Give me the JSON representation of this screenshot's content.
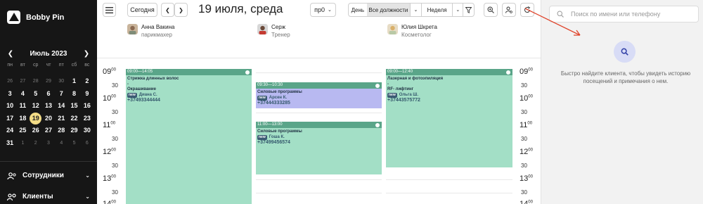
{
  "brand": {
    "name": "Bobby Pin"
  },
  "mini_calendar": {
    "month_label": "Июль 2023",
    "weekdays": [
      "пн",
      "вт",
      "ср",
      "чт",
      "пт",
      "сб",
      "вс"
    ],
    "days": [
      {
        "d": "26",
        "muted": true
      },
      {
        "d": "27",
        "muted": true
      },
      {
        "d": "28",
        "muted": true
      },
      {
        "d": "29",
        "muted": true
      },
      {
        "d": "30",
        "muted": true
      },
      {
        "d": "1"
      },
      {
        "d": "2"
      },
      {
        "d": "3"
      },
      {
        "d": "4"
      },
      {
        "d": "5"
      },
      {
        "d": "6"
      },
      {
        "d": "7"
      },
      {
        "d": "8"
      },
      {
        "d": "9"
      },
      {
        "d": "10"
      },
      {
        "d": "11"
      },
      {
        "d": "12"
      },
      {
        "d": "13"
      },
      {
        "d": "14"
      },
      {
        "d": "15"
      },
      {
        "d": "16"
      },
      {
        "d": "17"
      },
      {
        "d": "18"
      },
      {
        "d": "19",
        "today": true
      },
      {
        "d": "20"
      },
      {
        "d": "21"
      },
      {
        "d": "22"
      },
      {
        "d": "23"
      },
      {
        "d": "24"
      },
      {
        "d": "25"
      },
      {
        "d": "26"
      },
      {
        "d": "27"
      },
      {
        "d": "28"
      },
      {
        "d": "29"
      },
      {
        "d": "30"
      },
      {
        "d": "31"
      },
      {
        "d": "1",
        "muted": true
      },
      {
        "d": "2",
        "muted": true
      },
      {
        "d": "3",
        "muted": true
      },
      {
        "d": "4",
        "muted": true
      },
      {
        "d": "5",
        "muted": true
      },
      {
        "d": "6",
        "muted": true
      }
    ]
  },
  "nav": {
    "staff": "Сотрудники",
    "clients": "Клиенты"
  },
  "toolbar": {
    "today": "Сегодня",
    "date_title": "19 июля, среда",
    "slot_select": "пр0",
    "view_day": "День",
    "view_positions": "Все должности",
    "view_week": "Неделя"
  },
  "staff": [
    {
      "name": "Анна Вакина",
      "role": "парикмахер"
    },
    {
      "name": "Серж",
      "role": "Тренер"
    },
    {
      "name": "Юлия Шкрета",
      "role": "Косметолог"
    }
  ],
  "times": {
    "hours": [
      "09",
      "10",
      "11",
      "12",
      "13",
      "14"
    ],
    "half": "30",
    "minutes": "00"
  },
  "appointments": [
    {
      "time": "09:00—14:05",
      "service": "Стрижка длинных волос",
      "dash": "-",
      "service2": "Окрашивание",
      "badge": "new",
      "client": "Диана С.",
      "phone": "+37493344444"
    },
    {
      "time": "09:30—10:30",
      "service": "Силовые программы",
      "badge": "new",
      "client": "Арсен К.",
      "phone": "+37444333285"
    },
    {
      "time": "11:00—13:00",
      "service": "Силовые программы",
      "badge": "new",
      "client": "Гоша К.",
      "phone": "+37499456574"
    },
    {
      "time": "09:00—12:40",
      "service": "Лазерная и фотоэпиляция",
      "dash": "-",
      "service2": "RF- лифтинг",
      "badge": "new",
      "client": "Ольга Ш.",
      "phone": "+37443575772"
    }
  ],
  "right_panel": {
    "search_placeholder": "Поиск по имени или телефону",
    "hint": "Быстро найдите клиента, чтобы увидеть историю посещений и примечания о нем."
  },
  "colors": {
    "accent": "#f3dc86",
    "appointment": "#a3dfc6",
    "appointment_header": "#5aa589",
    "appointment_alt": "#b8b9f1",
    "arrow": "#e0442b"
  },
  "icons": [
    "menu-icon",
    "chevron-left-icon",
    "chevron-right-icon",
    "chevron-down-icon",
    "filter-icon",
    "zoom-icon",
    "user-settings-icon",
    "refresh-icon",
    "search-icon",
    "info-icon",
    "check-icon"
  ]
}
